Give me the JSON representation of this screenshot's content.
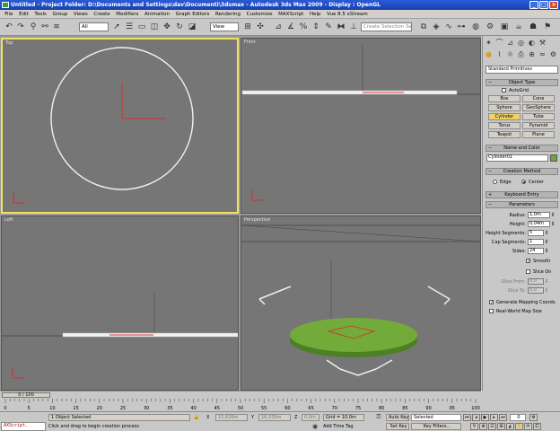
{
  "window": {
    "title": "Untitled    - Project Folder: D:\\Documents and Settings\\dav\\Documenti\\3dsmax     - Autodesk 3ds Max  2009          - Display : OpenGL",
    "minimize": "_",
    "maximize": "□",
    "close": "×"
  },
  "menu": [
    "File",
    "Edit",
    "Tools",
    "Group",
    "Views",
    "Create",
    "Modifiers",
    "Animation",
    "Graph Editors",
    "Rendering",
    "Customize",
    "MAXScript",
    "Help",
    "Vue 8.5 xStream"
  ],
  "toolbar": {
    "filter_value": "All",
    "refcoord_value": "View",
    "named_selection_placeholder": "Create Selection Set"
  },
  "viewports": {
    "top": "Top",
    "front": "Front",
    "left": "Left",
    "perspective": "Perspective"
  },
  "command_panel": {
    "category_dropdown": "Standard Primitives",
    "object_type_title": "Object Type",
    "autogrid_label": "AutoGrid",
    "object_buttons": [
      "Box",
      "Cone",
      "Sphere",
      "GeoSphere",
      "Cylinder",
      "Tube",
      "Torus",
      "Pyramid",
      "Teapot",
      "Plane"
    ],
    "active_object": "Cylinder",
    "name_color_title": "Name and Color",
    "object_name": "Cylinder01",
    "object_color": "#6ea43a",
    "creation_method_title": "Creation Method",
    "edge_label": "Edge",
    "center_label": "Center",
    "keyboard_entry_title": "Keyboard Entry",
    "parameters_title": "Parameters",
    "radius_label": "Radius:",
    "radius_value": "1,0m",
    "height_label": "Height:",
    "height_value": "0,04m",
    "height_segments_label": "Height Segments:",
    "height_segments_value": "5",
    "cap_segments_label": "Cap Segments:",
    "cap_segments_value": "1",
    "sides_label": "Sides:",
    "sides_value": "24",
    "smooth_label": "Smooth",
    "slice_on_label": "Slice On",
    "slice_from_label": "Slice From:",
    "slice_from_value": "0,0",
    "slice_to_label": "Slice To:",
    "slice_to_value": "0,0",
    "gen_mapping_label": "Generate Mapping Coords.",
    "real_world_label": "Real-World Map Size",
    "smooth_checked": true,
    "gen_mapping_checked": true
  },
  "timeline": {
    "frame_label": "0 / 100",
    "ticks": [
      "0",
      "5",
      "10",
      "15",
      "20",
      "25",
      "30",
      "35",
      "40",
      "45",
      "50",
      "55",
      "60",
      "65",
      "70",
      "75",
      "80",
      "85",
      "90",
      "95",
      "100"
    ]
  },
  "status": {
    "maxscript_label": "AXScript.",
    "selection_status": "1 Object Selected",
    "prompt": "Click and drag to begin creation process",
    "x_label": "X",
    "x_value": "15,626m",
    "y_label": "Y",
    "y_value": "16,335m",
    "z_label": "Z",
    "z_value": "0,0m",
    "grid": "Grid = 10,0m",
    "add_time_tag": "Add Time Tag",
    "auto_key": "Auto Key",
    "auto_key_dropdown": "Selected",
    "set_key": "Set Key",
    "key_filters": "Key Filters...",
    "frame_value": "0"
  }
}
